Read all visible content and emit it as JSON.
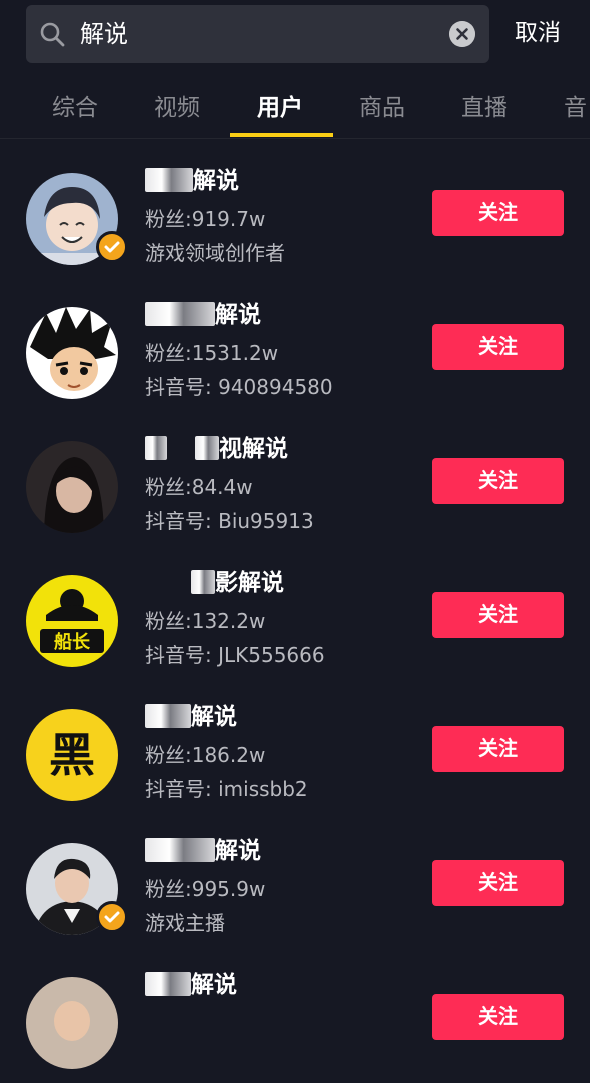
{
  "search": {
    "query": "解说",
    "cancel_label": "取消"
  },
  "tabs": [
    {
      "label": "综合"
    },
    {
      "label": "视频"
    },
    {
      "label": "用户"
    },
    {
      "label": "商品"
    },
    {
      "label": "直播"
    },
    {
      "label": "音"
    }
  ],
  "active_tab": "用户",
  "users": [
    {
      "name_suffix": "解说",
      "fans": "粉丝:919.7w",
      "meta": "游戏领域创作者",
      "follow_label": "关注",
      "verified": true
    },
    {
      "name_suffix": "解说",
      "fans": "粉丝:1531.2w",
      "meta": "抖音号: 940894580",
      "follow_label": "关注",
      "verified": false
    },
    {
      "name_suffix": "视解说",
      "fans": "粉丝:84.4w",
      "meta": "抖音号: Biu95913",
      "follow_label": "关注",
      "verified": false
    },
    {
      "name_suffix": "影解说",
      "fans": "粉丝:132.2w",
      "meta": "抖音号: JLK555666",
      "follow_label": "关注",
      "verified": false,
      "avatar_text": "船长"
    },
    {
      "name_suffix": "解说",
      "fans": "粉丝:186.2w",
      "meta": "抖音号: imissbb2",
      "follow_label": "关注",
      "verified": false,
      "avatar_text": "黑"
    },
    {
      "name_suffix": "解说",
      "fans": "粉丝:995.9w",
      "meta": "游戏主播",
      "follow_label": "关注",
      "verified": true
    },
    {
      "name_suffix": "解说",
      "fans": "",
      "meta": "",
      "follow_label": "关注",
      "verified": false
    }
  ],
  "colors": {
    "background": "#161823",
    "accent": "#face15",
    "follow": "#fe2c55",
    "badge": "#f4a51c"
  }
}
